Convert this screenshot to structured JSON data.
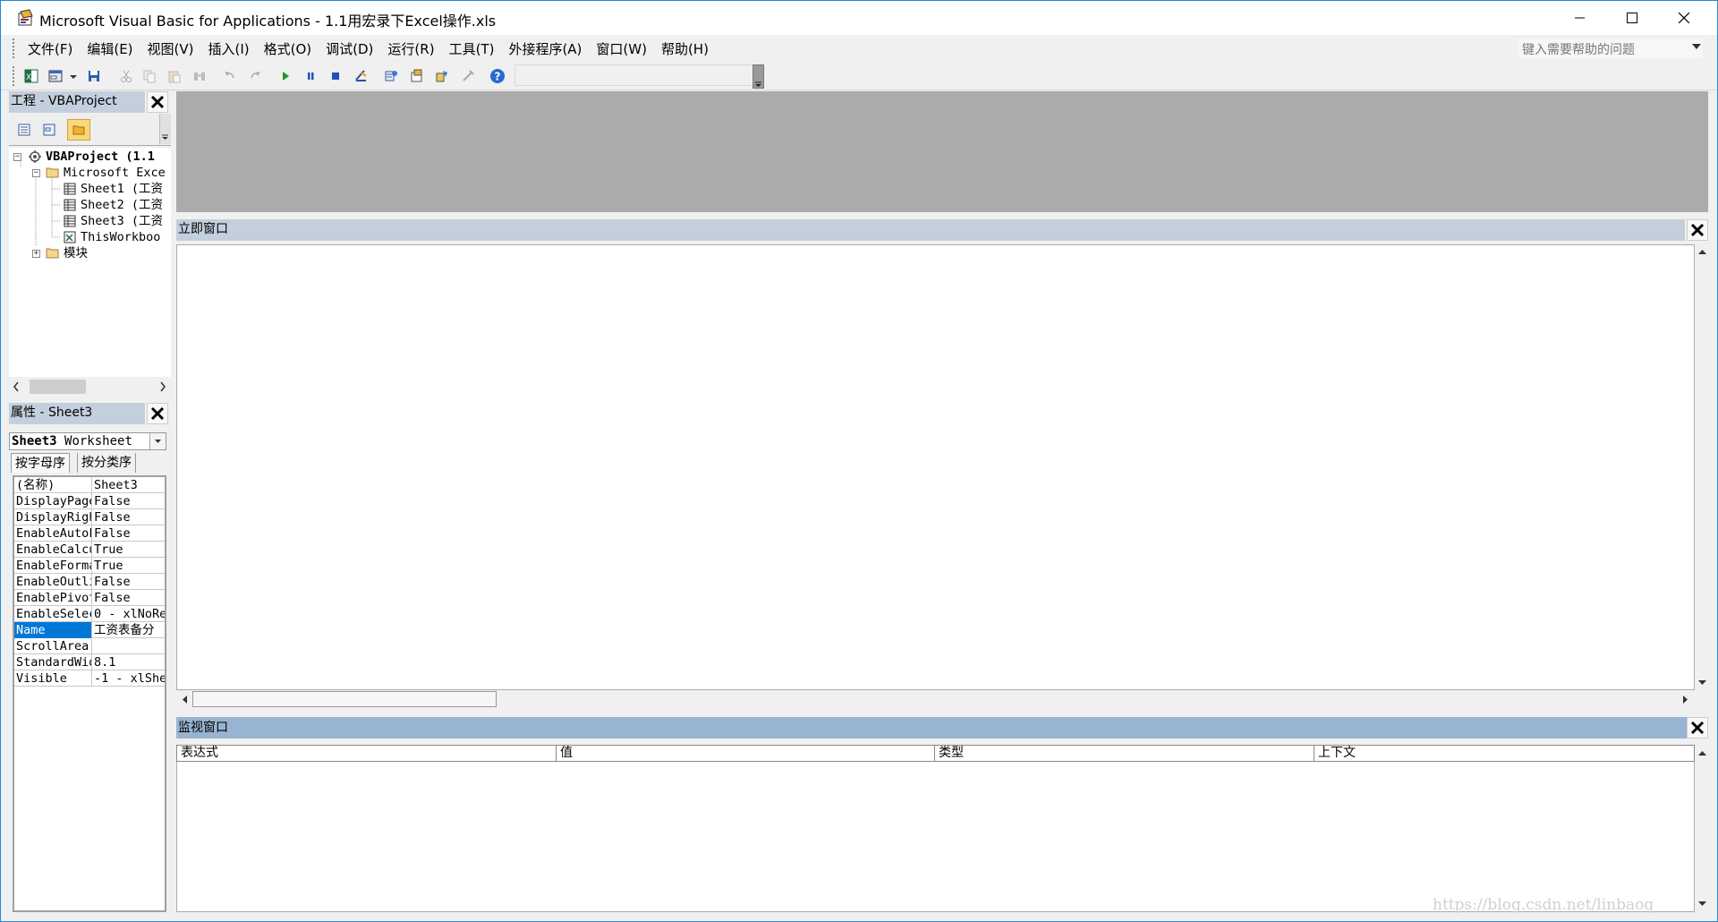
{
  "window": {
    "title": "Microsoft Visual Basic for Applications - 1.1用宏录下Excel操作.xls"
  },
  "menu": {
    "items": [
      "文件(F)",
      "编辑(E)",
      "视图(V)",
      "插入(I)",
      "格式(O)",
      "调试(D)",
      "运行(R)",
      "工具(T)",
      "外接程序(A)",
      "窗口(W)",
      "帮助(H)"
    ],
    "help_placeholder": "键入需要帮助的问题"
  },
  "toolbar": {
    "icons": [
      "excel-view-icon",
      "insert-userform-icon",
      "dropdown-arrow-icon",
      "save-icon",
      "cut-icon",
      "copy-icon",
      "paste-icon",
      "find-icon",
      "undo-icon",
      "redo-icon",
      "run-icon",
      "break-icon",
      "reset-icon",
      "design-mode-icon",
      "project-explorer-icon",
      "properties-window-icon",
      "object-browser-icon",
      "toolbox-icon",
      "help-icon"
    ]
  },
  "project_explorer": {
    "title": "工程 - VBAProject",
    "tree": [
      {
        "label": "VBAProject (1.1",
        "level": 0,
        "expanded": true,
        "icon": "vbaproject-icon",
        "bold": true
      },
      {
        "label": "Microsoft Exce",
        "level": 1,
        "expanded": true,
        "icon": "folder-icon"
      },
      {
        "label": "Sheet1 (工资",
        "level": 2,
        "icon": "sheet-icon"
      },
      {
        "label": "Sheet2 (工资",
        "level": 2,
        "icon": "sheet-icon"
      },
      {
        "label": "Sheet3 (工资",
        "level": 2,
        "icon": "sheet-icon"
      },
      {
        "label": "ThisWorkboo",
        "level": 2,
        "icon": "workbook-icon"
      },
      {
        "label": "模块",
        "level": 1,
        "expanded": false,
        "icon": "folder-icon"
      }
    ]
  },
  "properties": {
    "title": "属性 - Sheet3",
    "object_name": "Sheet3",
    "object_type": "Worksheet",
    "tabs": [
      "按字母序",
      "按分类序"
    ],
    "rows": [
      {
        "name": "(名称)",
        "value": "Sheet3"
      },
      {
        "name": "DisplayPage",
        "value": "False"
      },
      {
        "name": "DisplayRigh",
        "value": "False"
      },
      {
        "name": "EnableAutoF",
        "value": "False"
      },
      {
        "name": "EnableCalcu",
        "value": "True"
      },
      {
        "name": "EnableForma",
        "value": "True"
      },
      {
        "name": "EnableOutli",
        "value": "False"
      },
      {
        "name": "EnablePivot",
        "value": "False"
      },
      {
        "name": "EnableSelec",
        "value": "0 - xlNoRe"
      },
      {
        "name": "Name",
        "value": "工资表备分",
        "selected": true
      },
      {
        "name": "ScrollArea",
        "value": ""
      },
      {
        "name": "StandardWid",
        "value": "8.1"
      },
      {
        "name": "Visible",
        "value": "-1 - xlShe"
      }
    ]
  },
  "immediate": {
    "title": "立即窗口"
  },
  "watch": {
    "title": "监视窗口",
    "columns": [
      "表达式",
      "值",
      "类型",
      "上下文"
    ]
  },
  "watermark": "https://blog.csdn.net/linbaoq"
}
